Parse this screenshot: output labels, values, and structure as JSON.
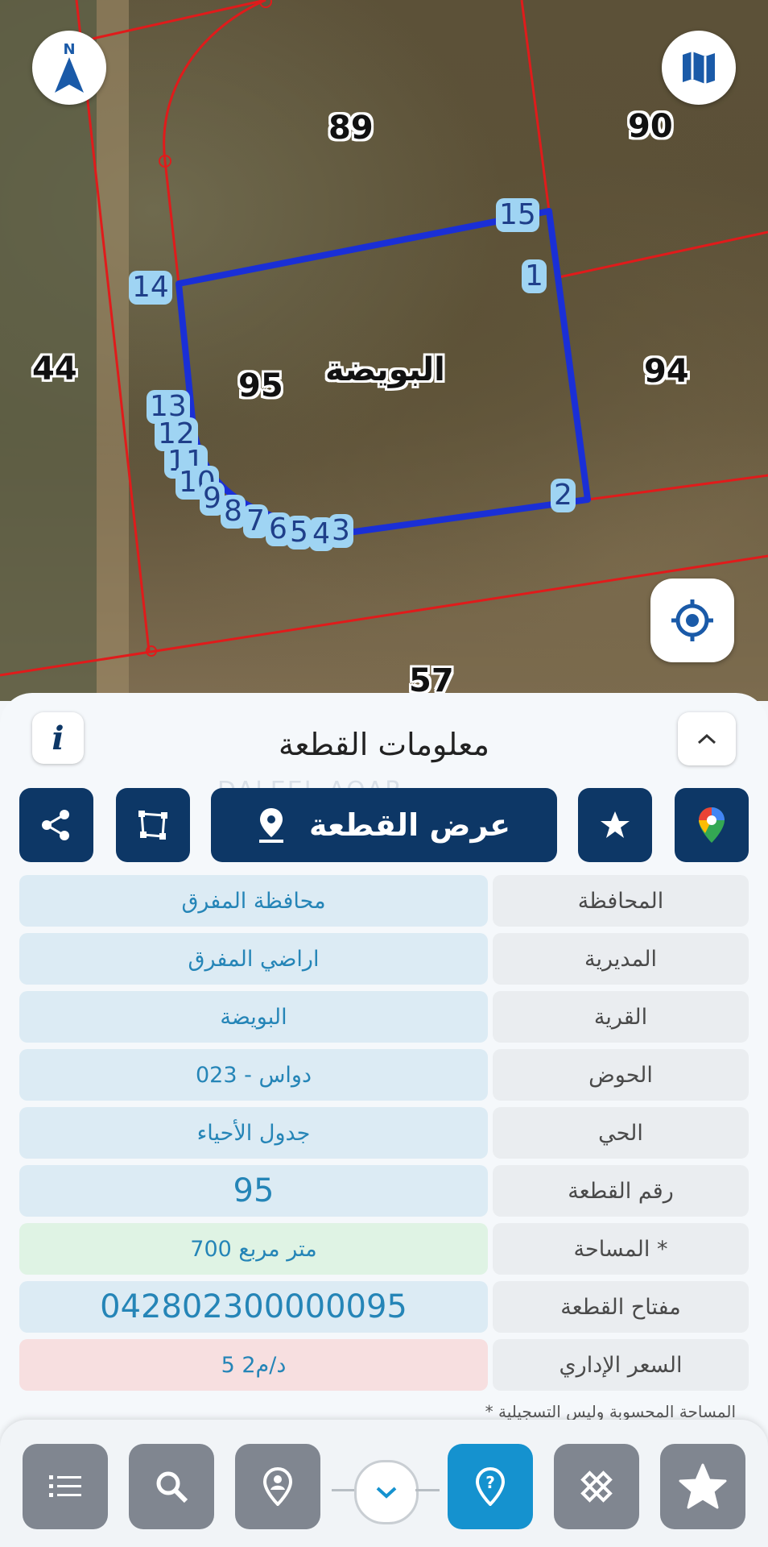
{
  "map": {
    "parcel_labels": [
      "89",
      "90",
      "95",
      "94",
      "44",
      "57"
    ],
    "village_label": "البويضة",
    "vertex_labels": [
      "15",
      "1",
      "14",
      "13",
      "12",
      "11",
      "10",
      "9",
      "8",
      "7",
      "6",
      "5",
      "4",
      "3",
      "2"
    ],
    "compass_letter": "N"
  },
  "panel": {
    "title": "معلومات القطعة",
    "info_icon": "i",
    "show_parcel_label": "عرض القطعة",
    "watermark": "DALEEL AQAR",
    "rows": [
      {
        "key": "المحافظة",
        "value": "محافظة المفرق"
      },
      {
        "key": "المديرية",
        "value": "اراضي المفرق"
      },
      {
        "key": "القرية",
        "value": "البويضة"
      },
      {
        "key": "الحوض",
        "value": "دواس - 023"
      },
      {
        "key": "الحي",
        "value": "جدول الأحياء"
      },
      {
        "key": "رقم القطعة",
        "value": "95"
      },
      {
        "key": "المساحة *",
        "value": "700  متر مربع"
      },
      {
        "key": "مفتاح القطعة",
        "value": "042802300000095"
      },
      {
        "key": "السعر الإداري",
        "value": "5 د/م2"
      }
    ],
    "footnote": "* المساحة المحسوبة وليس التسجيلية"
  },
  "colors": {
    "primary": "#0d3766",
    "accent": "#1592cf",
    "value_text": "#2585b7",
    "parcel_outline": "#1a2fd6",
    "boundary_red": "#e01b1b"
  }
}
